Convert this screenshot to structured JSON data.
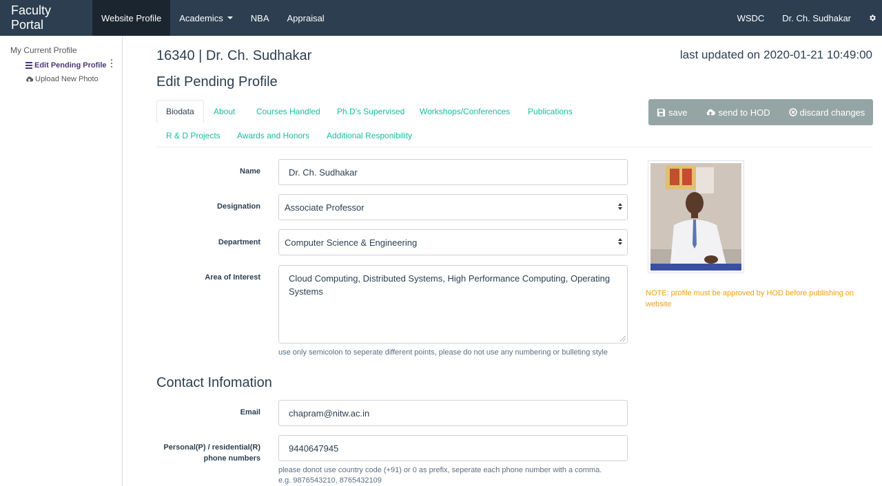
{
  "navbar": {
    "brand": "Faculty Portal",
    "items": [
      {
        "label": "Website Profile",
        "active": true
      },
      {
        "label": "Academics",
        "dropdown": true
      },
      {
        "label": "NBA"
      },
      {
        "label": "Appraisal"
      }
    ],
    "right": {
      "org": "WSDC",
      "user": "Dr. Ch. Sudhakar",
      "settings_icon": "gear-icon"
    }
  },
  "sidebar": {
    "title": "My Current Profile",
    "items": [
      {
        "label": "Edit Pending Profile",
        "icon": "list-icon",
        "active": true
      },
      {
        "label": "Upload New Photo",
        "icon": "cloud-upload-icon"
      }
    ]
  },
  "header": {
    "title": "16340 | Dr. Ch. Sudhakar",
    "last_updated_label": "last updated on",
    "last_updated_value": "2020-01-21 10:49:00",
    "subtitle": "Edit Pending Profile"
  },
  "tabs": [
    {
      "label": "Biodata",
      "active": true
    },
    {
      "label": "About"
    },
    {
      "label": "Courses Handled"
    },
    {
      "label": "Ph.D's Supervised"
    },
    {
      "label": "Workshops/Conferences"
    },
    {
      "label": "Publications"
    },
    {
      "label": "R & D Projects"
    },
    {
      "label": "Awards and Honors"
    },
    {
      "label": "Additional Responibility"
    }
  ],
  "actions": {
    "save": "save",
    "send": "send to HOD",
    "discard": "discard changes"
  },
  "form": {
    "name_label": "Name",
    "name_value": "Dr. Ch. Sudhakar",
    "designation_label": "Designation",
    "designation_value": "Associate Professor",
    "department_label": "Department",
    "department_value": "Computer Science & Engineering",
    "interest_label": "Area of Interest",
    "interest_value": "Cloud Computing, Distributed Systems, High Performance Computing, Operating Systems",
    "interest_help": "use only semicolon to seperate different points, please do not use any numbering or bulleting style"
  },
  "contact": {
    "title": "Contact Infomation",
    "email_label": "Email",
    "email_value": "chapram@nitw.ac.in",
    "phone_label_1": "Personal(P) / residential(R)",
    "phone_label_2": "phone numbers",
    "phone_value": "9440647945",
    "phone_help_1": "please donot use country code (+91) or 0 as prefix, seperate each phone number with a comma.",
    "phone_help_2": "e.g. 9876543210, 8765432109"
  },
  "note": "NOTE: profile must be approved by HOD before publishing on website",
  "colors": {
    "navbar": "#2c3e50",
    "accent": "#18bc9c",
    "warning": "#f39c12",
    "action_bar": "#95a5a6"
  }
}
